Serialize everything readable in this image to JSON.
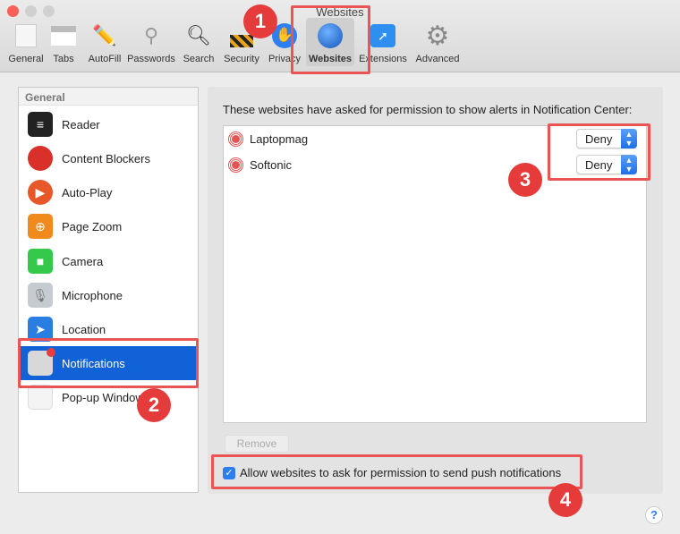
{
  "window": {
    "title": "Websites"
  },
  "toolbar": {
    "items": [
      {
        "label": "General",
        "icon": "general-switch-icon"
      },
      {
        "label": "Tabs",
        "icon": "tabs-icon"
      },
      {
        "label": "AutoFill",
        "icon": "pencil-icon"
      },
      {
        "label": "Passwords",
        "icon": "key-icon"
      },
      {
        "label": "Search",
        "icon": "magnifier-icon"
      },
      {
        "label": "Security",
        "icon": "lock-icon"
      },
      {
        "label": "Privacy",
        "icon": "hand-icon"
      },
      {
        "label": "Websites",
        "icon": "globe-icon",
        "selected": true
      },
      {
        "label": "Extensions",
        "icon": "puzzle-compass-icon"
      },
      {
        "label": "Advanced",
        "icon": "gear-icon"
      }
    ]
  },
  "sidebar": {
    "header": "General",
    "items": [
      {
        "label": "Reader",
        "color": "#222222"
      },
      {
        "label": "Content Blockers",
        "color": "#d9302a"
      },
      {
        "label": "Auto-Play",
        "color": "#e8572a"
      },
      {
        "label": "Page Zoom",
        "color": "#f08a1c"
      },
      {
        "label": "Camera",
        "color": "#34c94a"
      },
      {
        "label": "Microphone",
        "color": "#c5cbd0"
      },
      {
        "label": "Location",
        "color": "#2a7de1"
      },
      {
        "label": "Notifications",
        "color": "#d8d8d8",
        "selected": true
      },
      {
        "label": "Pop-up Windows",
        "color": "#f4f4f4"
      }
    ]
  },
  "main": {
    "description": "These websites have asked for permission to show alerts in Notification Center:",
    "sites": [
      {
        "name": "Laptopmag",
        "permission": "Deny"
      },
      {
        "name": "Softonic",
        "permission": "Deny"
      }
    ],
    "remove_label": "Remove",
    "allow_checkbox": {
      "label": "Allow websites to ask for permission to send push notifications",
      "checked": true
    },
    "help_label": "?"
  },
  "annotations": [
    "1",
    "2",
    "3",
    "4"
  ],
  "colors": {
    "accent": "#1062d6",
    "annotation": "#ea5455"
  }
}
